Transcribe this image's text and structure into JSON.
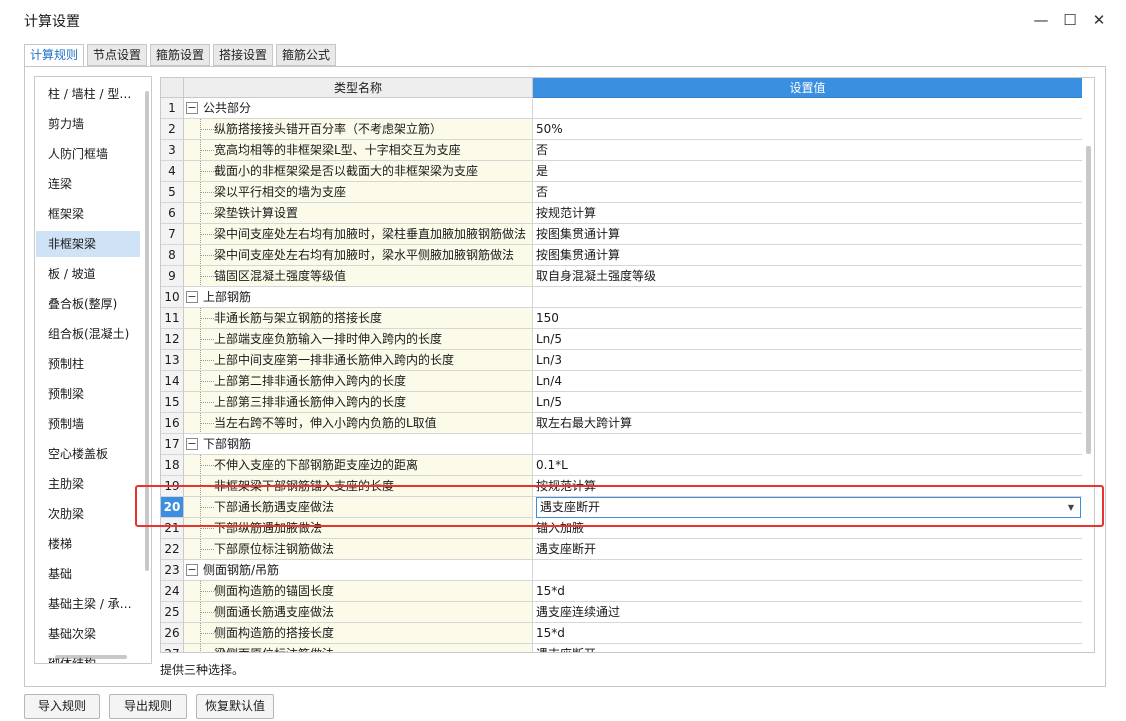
{
  "window": {
    "title": "计算设置",
    "minimize": "—",
    "maximize": "☐",
    "close": "✕"
  },
  "tabs": [
    "计算规则",
    "节点设置",
    "箍筋设置",
    "搭接设置",
    "箍筋公式"
  ],
  "sidebar": [
    "柱 / 墙柱 / 型…",
    "剪力墙",
    "人防门框墙",
    "连梁",
    "框架梁",
    "非框架梁",
    "板 / 坡道",
    "叠合板(整厚)",
    "组合板(混凝土)",
    "预制柱",
    "预制梁",
    "预制墙",
    "空心楼盖板",
    "主肋梁",
    "次肋梁",
    "楼梯",
    "基础",
    "基础主梁 / 承…",
    "基础次梁",
    "砌体结构"
  ],
  "grid": {
    "col_name": "类型名称",
    "col_value": "设置值",
    "rows": [
      {
        "n": "1",
        "name": "公共部分",
        "group": true,
        "value": ""
      },
      {
        "n": "2",
        "name": "纵筋搭接接头错开百分率（不考虑架立筋）",
        "value": "50%"
      },
      {
        "n": "3",
        "name": "宽高均相等的非框架梁L型、十字相交互为支座",
        "value": "否"
      },
      {
        "n": "4",
        "name": "截面小的非框架梁是否以截面大的非框架梁为支座",
        "value": "是"
      },
      {
        "n": "5",
        "name": "梁以平行相交的墙为支座",
        "value": "否"
      },
      {
        "n": "6",
        "name": "梁垫铁计算设置",
        "value": "按规范计算"
      },
      {
        "n": "7",
        "name": "梁中间支座处左右均有加腋时，梁柱垂直加腋加腋钢筋做法",
        "value": "按图集贯通计算"
      },
      {
        "n": "8",
        "name": "梁中间支座处左右均有加腋时，梁水平侧腋加腋钢筋做法",
        "value": "按图集贯通计算"
      },
      {
        "n": "9",
        "name": "锚固区混凝土强度等级值",
        "value": "取自身混凝土强度等级"
      },
      {
        "n": "10",
        "name": "上部钢筋",
        "group": true,
        "value": ""
      },
      {
        "n": "11",
        "name": "非通长筋与架立钢筋的搭接长度",
        "value": "150"
      },
      {
        "n": "12",
        "name": "上部端支座负筋输入一排时伸入跨内的长度",
        "value": "Ln/5"
      },
      {
        "n": "13",
        "name": "上部中间支座第一排非通长筋伸入跨内的长度",
        "value": "Ln/3"
      },
      {
        "n": "14",
        "name": "上部第二排非通长筋伸入跨内的长度",
        "value": "Ln/4"
      },
      {
        "n": "15",
        "name": "上部第三排非通长筋伸入跨内的长度",
        "value": "Ln/5"
      },
      {
        "n": "16",
        "name": "当左右跨不等时，伸入小跨内负筋的L取值",
        "value": "取左右最大跨计算"
      },
      {
        "n": "17",
        "name": "下部钢筋",
        "group": true,
        "value": ""
      },
      {
        "n": "18",
        "name": "不伸入支座的下部钢筋距支座边的距离",
        "value": "0.1*L"
      },
      {
        "n": "19",
        "name": "非框架梁下部钢筋锚入支座的长度",
        "value": "按规范计算"
      },
      {
        "n": "20",
        "name": "下部通长筋遇支座做法",
        "value": "遇支座断开",
        "current": true
      },
      {
        "n": "21",
        "name": "下部纵筋遇加腋做法",
        "value": "锚入加腋"
      },
      {
        "n": "22",
        "name": "下部原位标注钢筋做法",
        "value": "遇支座断开"
      },
      {
        "n": "23",
        "name": "侧面钢筋/吊筋",
        "group": true,
        "value": ""
      },
      {
        "n": "24",
        "name": "侧面构造筋的锚固长度",
        "value": "15*d"
      },
      {
        "n": "25",
        "name": "侧面通长筋遇支座做法",
        "value": "遇支座连续通过"
      },
      {
        "n": "26",
        "name": "侧面构造筋的搭接长度",
        "value": "15*d"
      },
      {
        "n": "27",
        "name": "梁侧面原位标注筋做法",
        "value": "遇支座断开"
      }
    ]
  },
  "hint": "提供三种选择。",
  "buttons": {
    "import": "导入规则",
    "export": "导出规则",
    "restore": "恢复默认值"
  }
}
